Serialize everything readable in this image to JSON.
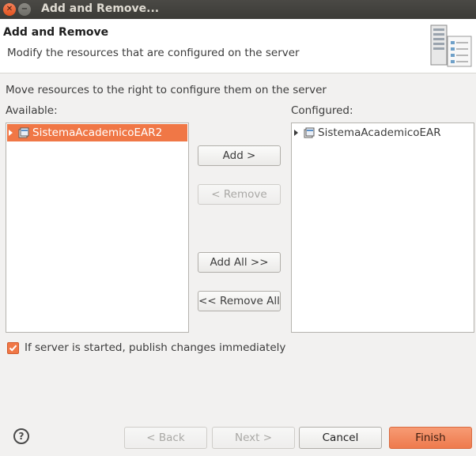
{
  "window": {
    "title": "Add and Remove...",
    "close_glyph": "✕",
    "minimize_glyph": "−"
  },
  "header": {
    "title": "Add and Remove",
    "description": "Modify the resources that are configured on the server",
    "graphic_icon": "server-icon"
  },
  "instructions": "Move resources to the right to configure them on the server",
  "available": {
    "label": "Available:",
    "items": [
      {
        "label": "SistemaAcademicoEAR2",
        "icon": "ear-project-icon",
        "selected": true
      }
    ]
  },
  "configured": {
    "label": "Configured:",
    "items": [
      {
        "label": "SistemaAcademicoEAR",
        "icon": "ear-project-icon",
        "selected": false
      }
    ]
  },
  "actions": {
    "add": "Add >",
    "remove": "< Remove",
    "add_all": "Add All >>",
    "remove_all": "<< Remove All"
  },
  "publish": {
    "label": "If server is started, publish changes immediately",
    "checked": true
  },
  "footer": {
    "help_glyph": "?",
    "back": "< Back",
    "next": "Next >",
    "cancel": "Cancel",
    "finish": "Finish"
  },
  "colors": {
    "accent": "#f07746",
    "titlebar": "#3c3b37",
    "background": "#f2f1f0"
  }
}
